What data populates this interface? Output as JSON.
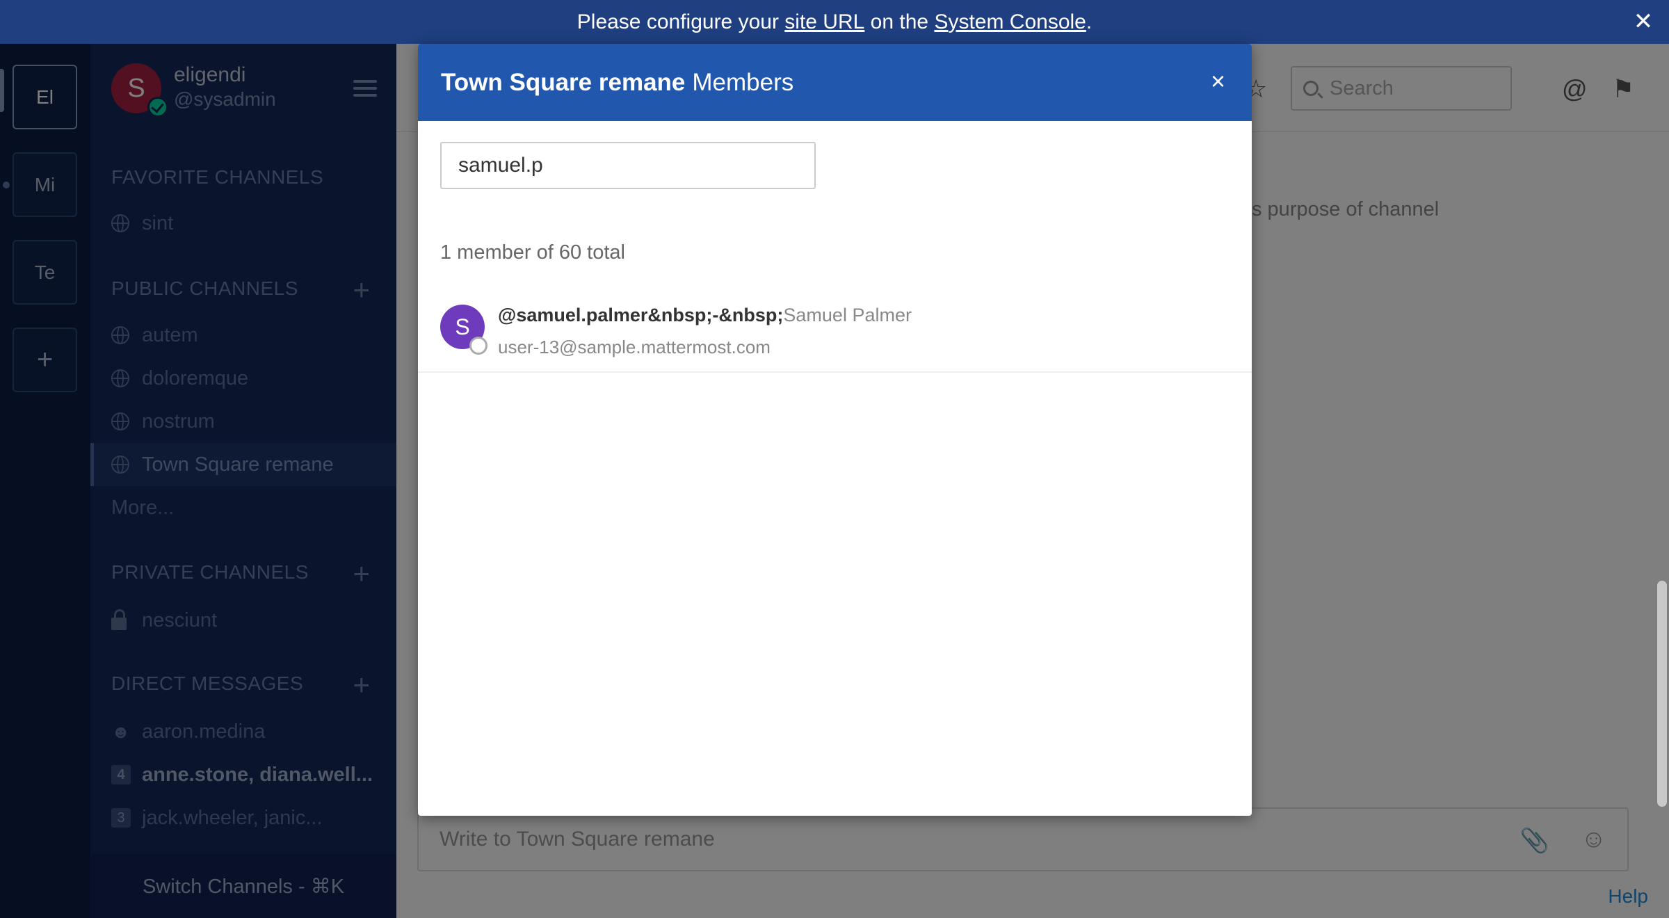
{
  "banner": {
    "prefix": "Please configure your",
    "link1": "site URL",
    "middle": "on the",
    "link2": "System Console",
    "suffix": ".",
    "close": "✕"
  },
  "teams": {
    "items": [
      {
        "label": "El"
      },
      {
        "label": "Mi"
      },
      {
        "label": "Te"
      }
    ],
    "add": "+"
  },
  "sidebar": {
    "avatar_letter": "S",
    "username": "eligendi",
    "handle": "@sysadmin",
    "favorites_title": "FAVORITE CHANNELS",
    "favorites": [
      {
        "label": "sint"
      }
    ],
    "public_title": "PUBLIC CHANNELS",
    "public": [
      {
        "label": "autem"
      },
      {
        "label": "doloremque"
      },
      {
        "label": "nostrum"
      },
      {
        "label": "Town Square remane"
      }
    ],
    "more": "More...",
    "private_title": "PRIVATE CHANNELS",
    "private": [
      {
        "label": "nesciunt"
      }
    ],
    "dm_title": "DIRECT MESSAGES",
    "dms": [
      {
        "label": "aaron.medina"
      },
      {
        "label": "anne.stone, diana.well...",
        "count": "4"
      },
      {
        "label": "jack.wheeler, janic...",
        "count": "3"
      }
    ],
    "plus": "+",
    "switch": "Switch Channels - ⌘K"
  },
  "center": {
    "search_placeholder": "Search",
    "purpose_fragment": "s purpose of channel",
    "post_placeholder": "Write to Town Square remane",
    "help": "Help"
  },
  "modal": {
    "channel": "Town Square remane",
    "title_suffix": "Members",
    "close": "×",
    "filter_value": "samuel.p",
    "count": "1 member of 60 total",
    "members": [
      {
        "avatar_letter": "S",
        "username": "@samuel.palmer&nbsp;-&nbsp;",
        "full_name": "Samuel Palmer",
        "email": "user-13@sample.mattermost.com"
      }
    ]
  },
  "colors": {
    "banner": "#1f3f80",
    "sidebar": "#14295a",
    "modal_header": "#2157ad",
    "member_avatar": "#6f3bbd"
  }
}
